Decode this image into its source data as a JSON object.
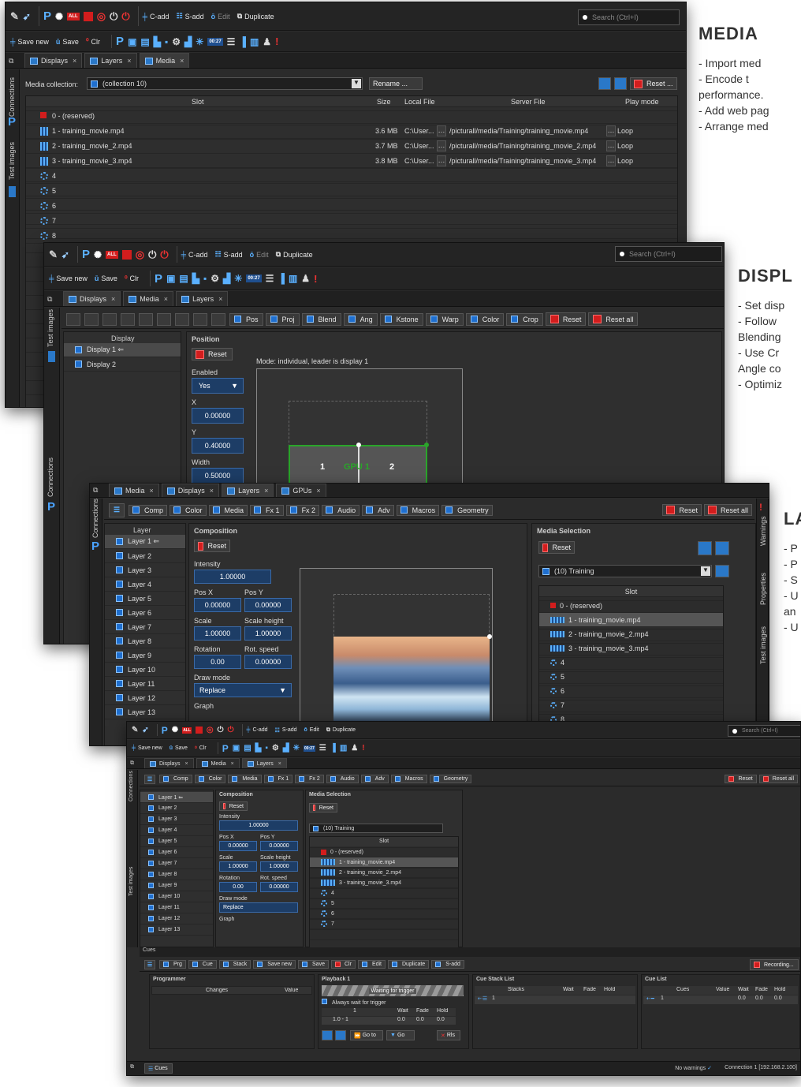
{
  "toolbar": {
    "c_add": "C-add",
    "s_add": "S-add",
    "edit": "Edit",
    "duplicate": "Duplicate",
    "save_new": "Save new",
    "save": "Save",
    "clr": "Clr",
    "search_placeholder": "Search (Ctrl+I)",
    "all_badge": "ALL",
    "time_badge": "00:27"
  },
  "side": {
    "connections": "Connections",
    "test_images": "Test images",
    "warnings": "Warnings",
    "properties": "Properties",
    "p_logo": "P"
  },
  "media_win": {
    "tabs": [
      "Displays",
      "Layers",
      "Media"
    ],
    "collection_label": "Media collection:",
    "collection_value": "(collection 10)",
    "rename": "Rename ...",
    "reset": "Reset ...",
    "columns": [
      "Slot",
      "Size",
      "Local File",
      "Server File",
      "Play mode"
    ],
    "rows": [
      {
        "slot": "0 - (reserved)",
        "size": "",
        "local": "",
        "server": "",
        "mode": ""
      },
      {
        "slot": "1 - training_movie.mp4",
        "size": "3.6 MB",
        "local": "C:\\User...",
        "server": "/picturall/media/Training/training_movie.mp4",
        "mode": "Loop"
      },
      {
        "slot": "2 - training_movie_2.mp4",
        "size": "3.7 MB",
        "local": "C:\\User...",
        "server": "/picturall/media/Training/training_movie_2.mp4",
        "mode": "Loop"
      },
      {
        "slot": "3 - training_movie_3.mp4",
        "size": "3.8 MB",
        "local": "C:\\User...",
        "server": "/picturall/media/Training/training_movie_3.mp4",
        "mode": "Loop"
      },
      {
        "slot": "4"
      },
      {
        "slot": "5"
      },
      {
        "slot": "6"
      },
      {
        "slot": "7"
      },
      {
        "slot": "8"
      }
    ]
  },
  "display_win": {
    "tabs": [
      "Displays",
      "Media",
      "Layers"
    ],
    "tools": [
      "Pos",
      "Proj",
      "Blend",
      "Ang",
      "Kstone",
      "Warp",
      "Color",
      "Crop",
      "Reset",
      "Reset all"
    ],
    "display_header": "Display",
    "displays": [
      "Display 1 ⇐",
      "Display 2"
    ],
    "position_header": "Position",
    "reset": "Reset",
    "enabled_label": "Enabled",
    "enabled_value": "Yes",
    "x_label": "X",
    "x_value": "0.00000",
    "y_label": "Y",
    "y_value": "0.40000",
    "width_label": "Width",
    "width_value": "0.50000",
    "mode_text": "Mode: individual, leader is display 1",
    "gpu_label": "GPU 1",
    "d1": "1",
    "d2": "2"
  },
  "layers_win": {
    "tabs": [
      "Media",
      "Displays",
      "Layers",
      "GPUs"
    ],
    "tools": [
      "Comp",
      "Color",
      "Media",
      "Fx 1",
      "Fx 2",
      "Audio",
      "Adv",
      "Macros",
      "Geometry",
      "Reset",
      "Reset all"
    ],
    "layer_header": "Layer",
    "layers": [
      "Layer 1 ⇐",
      "Layer 2",
      "Layer 3",
      "Layer 4",
      "Layer 5",
      "Layer 6",
      "Layer 7",
      "Layer 8",
      "Layer 9",
      "Layer 10",
      "Layer 11",
      "Layer 12",
      "Layer 13"
    ],
    "composition": "Composition",
    "reset": "Reset",
    "intensity_label": "Intensity",
    "intensity": "1.00000",
    "posx_label": "Pos X",
    "posx": "0.00000",
    "posy_label": "Pos Y",
    "posy": "0.00000",
    "scale_label": "Scale",
    "scale": "1.00000",
    "scaleh_label": "Scale height",
    "scaleh": "1.00000",
    "rot_label": "Rotation",
    "rot": "0.00",
    "rots_label": "Rot. speed",
    "rots": "0.00000",
    "draw_label": "Draw mode",
    "draw": "Replace",
    "graph_label": "Graph",
    "media_sel": "Media Selection",
    "collection": "(10) Training",
    "slot_header": "Slot",
    "slots": [
      "0 - (reserved)",
      "1 - training_movie.mp4",
      "2 - training_movie_2.mp4",
      "3 - training_movie_3.mp4",
      "4",
      "5",
      "6",
      "7",
      "8"
    ]
  },
  "cues_win": {
    "layers_tabs": [
      "Displays",
      "Media",
      "Layers"
    ],
    "layers": [
      "Layer 1 ⇐",
      "Layer 2",
      "Layer 3",
      "Layer 4",
      "Layer 5",
      "Layer 6",
      "Layer 7",
      "Layer 8",
      "Layer 9",
      "Layer 10",
      "Layer 11",
      "Layer 12",
      "Layer 13"
    ],
    "slots": [
      "0 - (reserved)",
      "1 - training_movie.mp4",
      "2 - training_movie_2.mp4",
      "3 - training_movie_3.mp4",
      "4",
      "5",
      "6",
      "7"
    ],
    "title": "Cues",
    "tools": [
      "Prg",
      "Cue",
      "Stack",
      "Save new",
      "Save",
      "Clr",
      "Edit",
      "Duplicate",
      "S-add"
    ],
    "recording": "Recording...",
    "programmer": "Programmer",
    "changes": "Changes",
    "value": "Value",
    "playback": "Playback 1",
    "waiting": "Waiting for trigger",
    "always_wait": "Always wait for trigger",
    "pb_cols": [
      "1",
      "Wait",
      "Fade",
      "Hold"
    ],
    "pb_row": [
      "1.0 - 1",
      "0.0",
      "0.0",
      "0.0"
    ],
    "goto": "Go to",
    "go": "Go",
    "rls": "Rls",
    "stack_list": "Cue Stack List",
    "stack_cols": [
      "Stacks",
      "Wait",
      "Fade",
      "Hold"
    ],
    "stack_row": "1",
    "cue_list": "Cue List",
    "cue_cols": [
      "Cues",
      "Value",
      "Wait",
      "Fade",
      "Hold"
    ],
    "cue_row": [
      "1",
      "0.0",
      "0.0",
      "0.0"
    ],
    "bottom_tab": "Cues",
    "status_warn": "No warnings",
    "status_conn": "Connection 1 [192.168.2.100]"
  },
  "right_text": {
    "media_title": "MEDIA",
    "media_lines": [
      "- Import med",
      "- Encode t",
      "performance.",
      "- Add web pag",
      "- Arrange med"
    ],
    "displ_title": "DISPL",
    "displ_lines": [
      "- Set disp",
      "- Follow",
      "Blending",
      "- Use Cr",
      "Angle co",
      "- Optimiz"
    ],
    "la_title": "LA",
    "la_lines": [
      "- P",
      "- P",
      "- S",
      "- U",
      "an",
      "- U"
    ]
  },
  "colors": {
    "accent": "#2a78c8",
    "red": "#d21d1d",
    "bg": "#2b2b2b",
    "green": "#2aa52a"
  }
}
